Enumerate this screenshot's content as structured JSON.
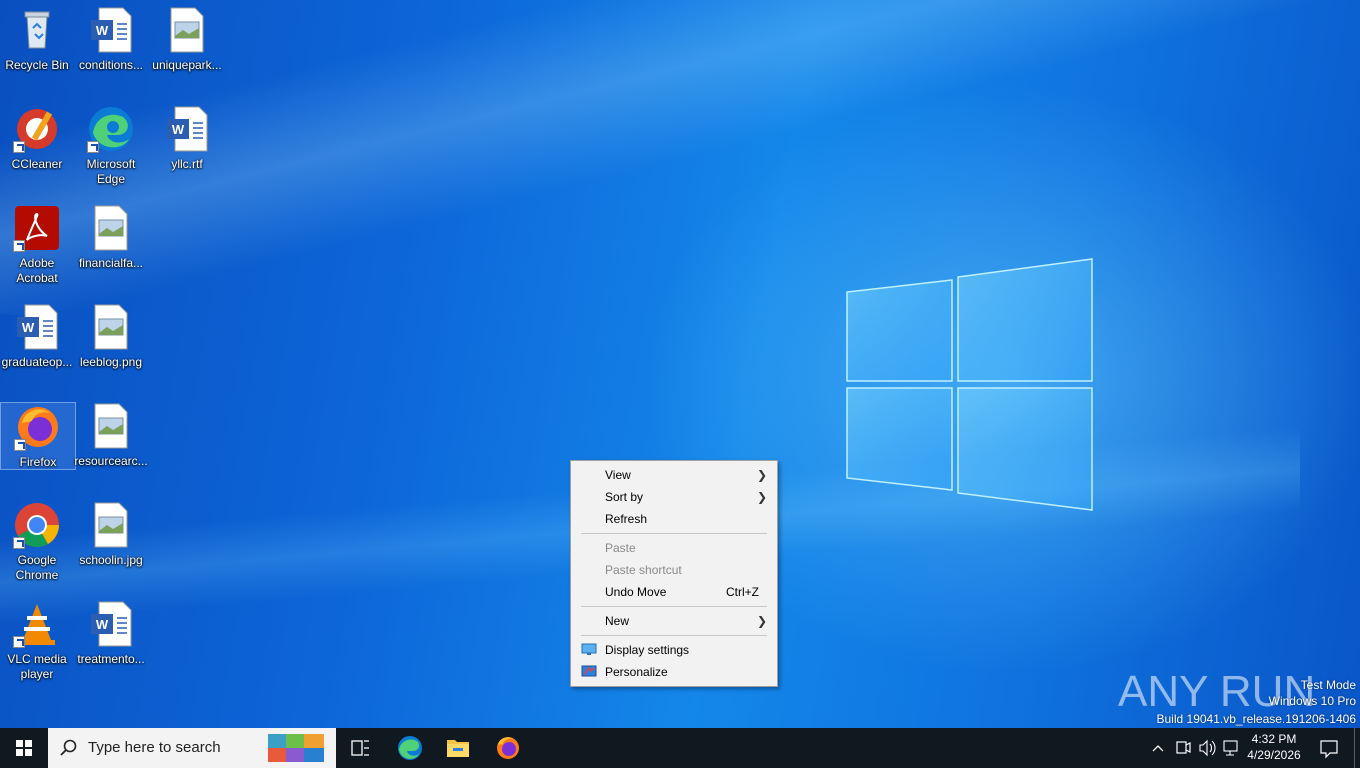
{
  "desktop": {
    "icons": [
      {
        "label": "Recycle Bin"
      },
      {
        "label": "conditions..."
      },
      {
        "label": "uniquepark..."
      },
      {
        "label": "CCleaner"
      },
      {
        "label": "Microsoft Edge"
      },
      {
        "label": "yllc.rtf"
      },
      {
        "label": "Adobe Acrobat"
      },
      {
        "label": "financialfa..."
      },
      {
        "label": "graduateop..."
      },
      {
        "label": "leeblog.png"
      },
      {
        "label": "Firefox"
      },
      {
        "label": "resourcearc..."
      },
      {
        "label": "Google Chrome"
      },
      {
        "label": "schoolin.jpg"
      },
      {
        "label": "VLC media player"
      },
      {
        "label": "treatmento..."
      }
    ]
  },
  "context_menu": {
    "items": [
      {
        "label": "View",
        "submenu": true
      },
      {
        "label": "Sort by",
        "submenu": true
      },
      {
        "label": "Refresh"
      },
      {
        "label": "Paste",
        "disabled": true
      },
      {
        "label": "Paste shortcut",
        "disabled": true
      },
      {
        "label": "Undo Move",
        "accelerator": "Ctrl+Z"
      },
      {
        "label": "New",
        "submenu": true
      },
      {
        "label": "Display settings",
        "icon": "display-icon"
      },
      {
        "label": "Personalize",
        "icon": "personalize-icon"
      }
    ]
  },
  "watermark": {
    "line1": "Test Mode",
    "line2": "Windows 10 Pro",
    "line3": "Build 19041.vb_release.191206-1406",
    "brand": "ANY RUN"
  },
  "taskbar": {
    "search_placeholder": "Type here to search",
    "time": "4:32 PM",
    "date": "4/29/2026",
    "pinned": [
      "task-view-icon",
      "edge-icon",
      "file-explorer-icon",
      "firefox-icon"
    ]
  },
  "colors": {
    "desktop_blue": "#0f74e0",
    "taskbar": "#101820",
    "menu_bg": "#f2f2f2"
  }
}
